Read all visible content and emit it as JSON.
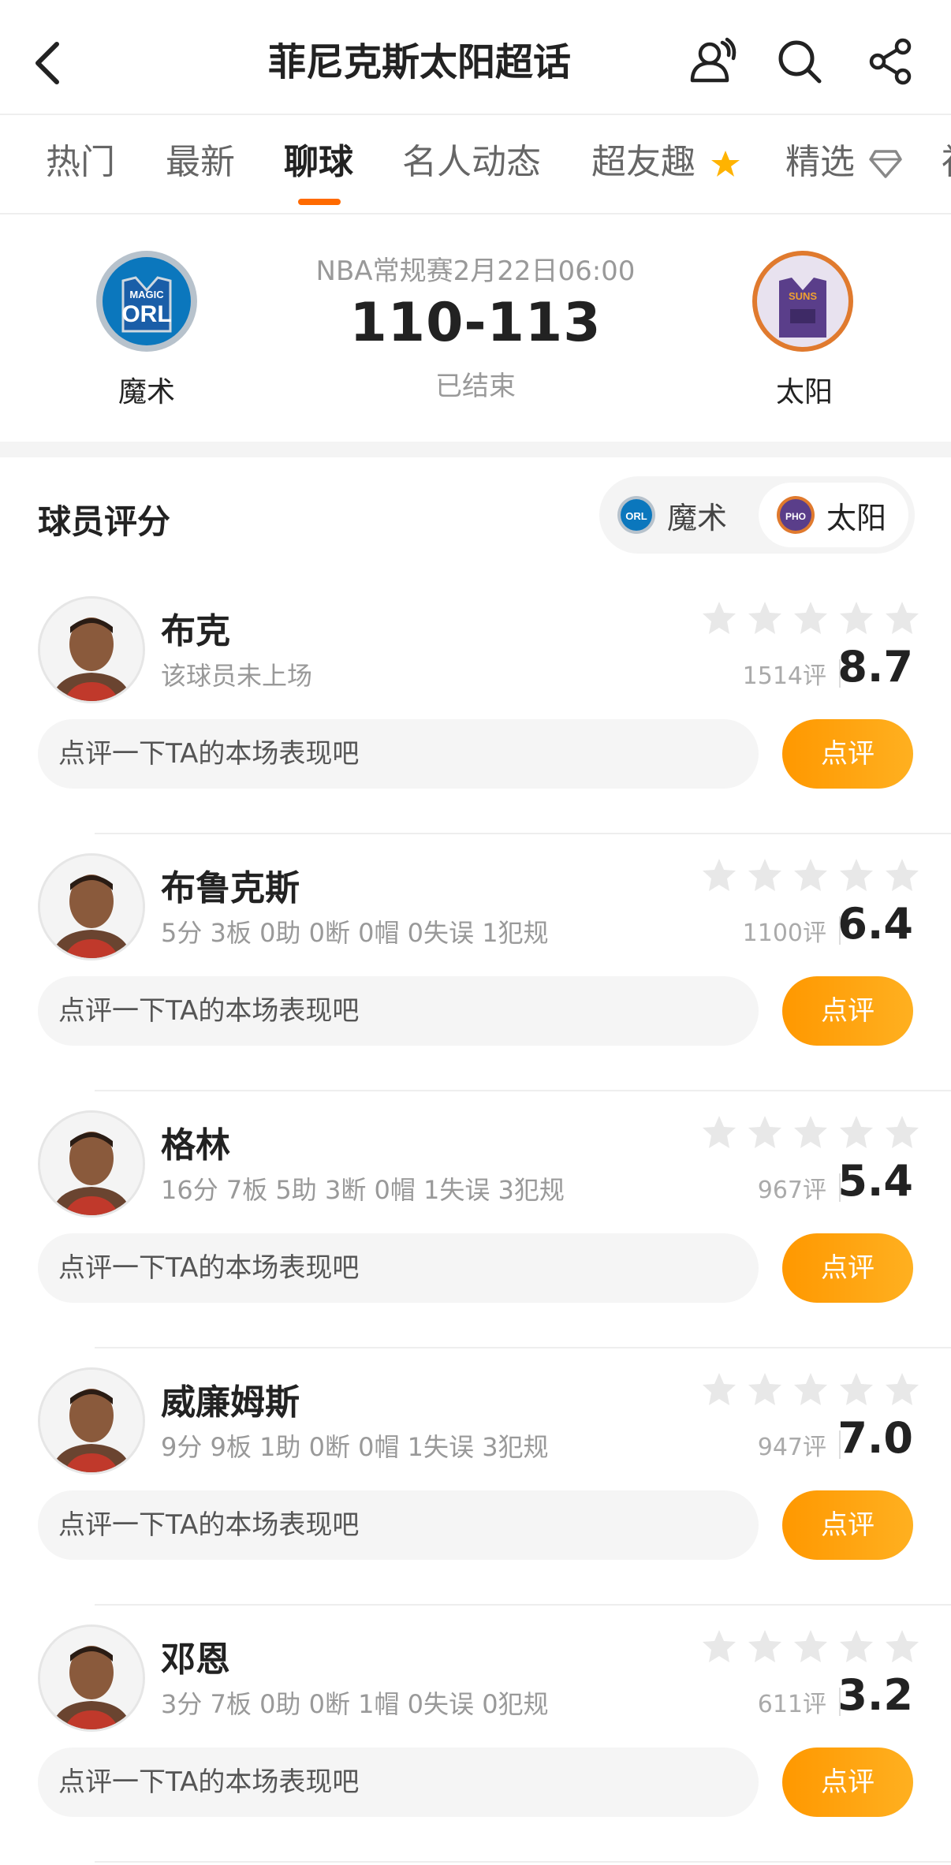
{
  "header": {
    "title": "菲尼克斯太阳超话"
  },
  "tabs": [
    {
      "label": "热门"
    },
    {
      "label": "最新"
    },
    {
      "label": "聊球"
    },
    {
      "label": "名人动态"
    },
    {
      "label": "超友趣"
    },
    {
      "label": "精选"
    }
  ],
  "match": {
    "info": "NBA常规赛2月22日06:00",
    "score": "110-113",
    "status": "已结束",
    "home": {
      "name": "魔术",
      "abbr": "ORL",
      "tag": "MAGIC",
      "color": "#0b77bd"
    },
    "away": {
      "name": "太阳",
      "tag": "SUNS",
      "color": "#5a3e8a"
    }
  },
  "ratings": {
    "title": "球员评分",
    "team_toggle": [
      {
        "name": "魔术",
        "abbr": "ORL"
      },
      {
        "name": "太阳",
        "abbr": "PHO"
      }
    ],
    "comment_placeholder": "点评一下TA的本场表现吧",
    "comment_button": "点评"
  },
  "players": [
    {
      "name": "布克",
      "stats": "该球员未上场",
      "count": "1514评",
      "score": "8.7"
    },
    {
      "name": "布鲁克斯",
      "stats": "5分 3板 0助 0断 0帽 0失误 1犯规",
      "count": "1100评",
      "score": "6.4"
    },
    {
      "name": "格林",
      "stats": "16分 7板 5助 3断 0帽 1失误 3犯规",
      "count": "967评",
      "score": "5.4"
    },
    {
      "name": "威廉姆斯",
      "stats": "9分 9板 1助 0断 0帽 1失误 3犯规",
      "count": "947评",
      "score": "7.0"
    },
    {
      "name": "邓恩",
      "stats": "3分 7板 0助 0断 1帽 0失误 0犯规",
      "count": "611评",
      "score": "3.2"
    }
  ],
  "colors": {
    "accent": "#ff6a00",
    "button": "#ffa010",
    "star": "#e8e8e8"
  }
}
